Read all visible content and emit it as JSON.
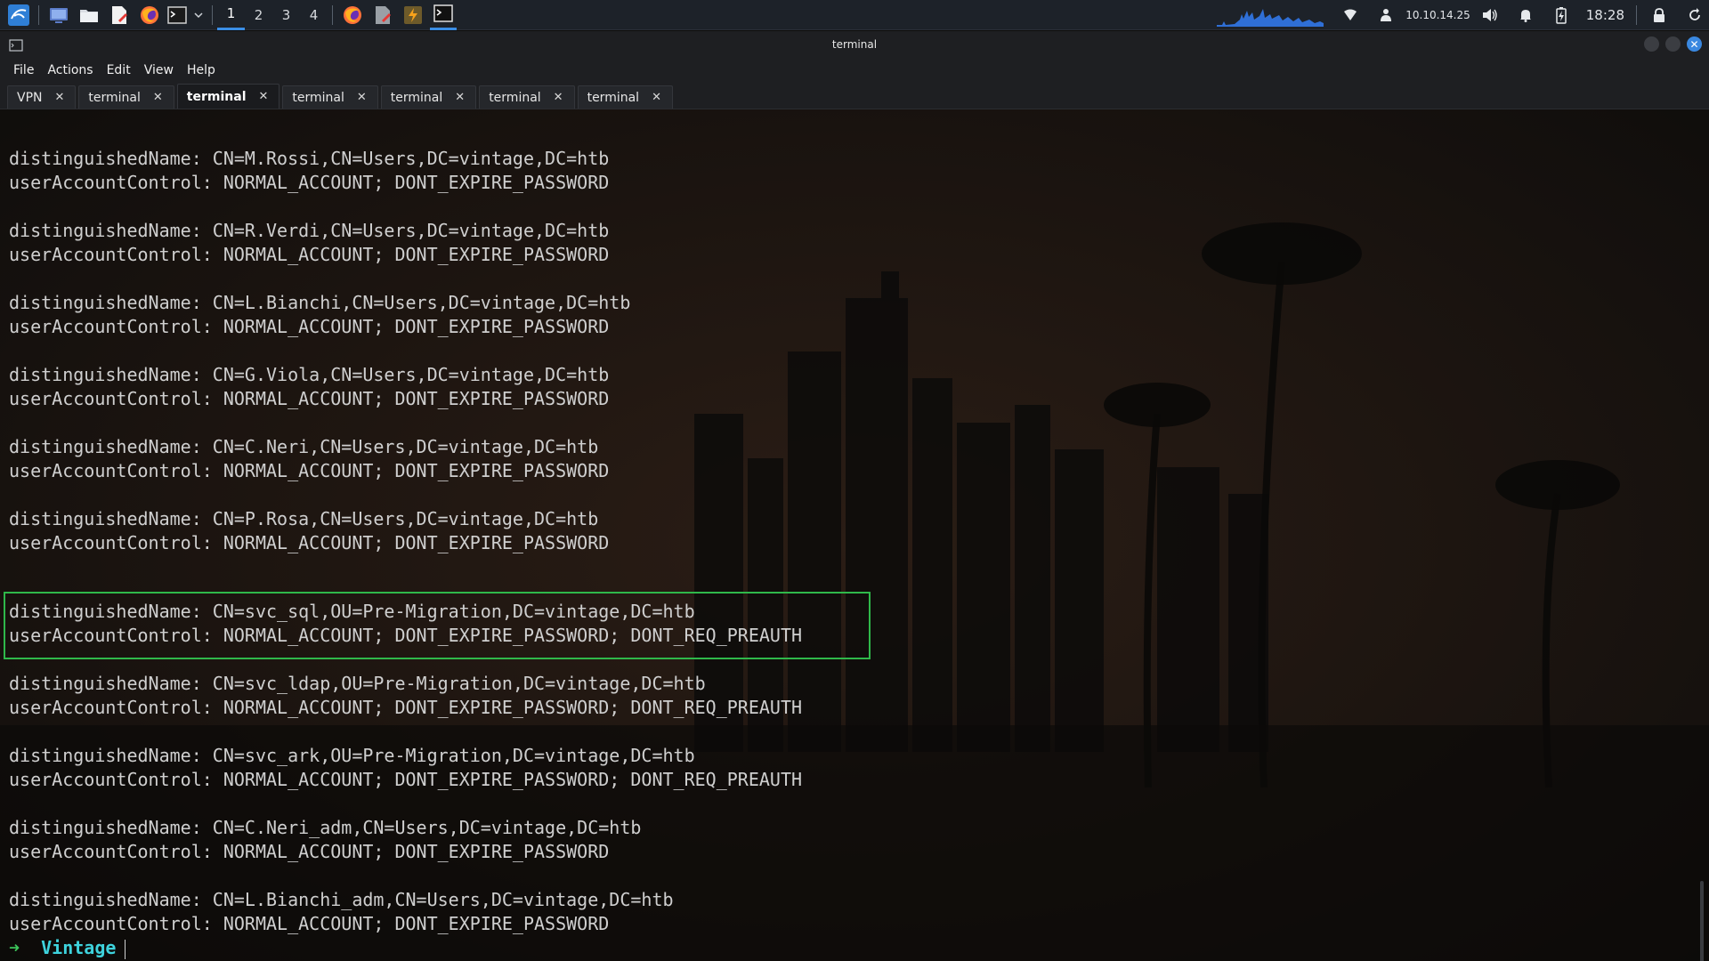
{
  "panel": {
    "workspaces": [
      "1",
      "2",
      "3",
      "4"
    ],
    "active_workspace": "1",
    "ip": "10.10.14.25",
    "clock": "18:28"
  },
  "window": {
    "title": "terminal",
    "menu": [
      "File",
      "Actions",
      "Edit",
      "View",
      "Help"
    ],
    "tabs": [
      {
        "label": "VPN",
        "active": false
      },
      {
        "label": "terminal",
        "active": false
      },
      {
        "label": "terminal",
        "active": true
      },
      {
        "label": "terminal",
        "active": false
      },
      {
        "label": "terminal",
        "active": false
      },
      {
        "label": "terminal",
        "active": false
      },
      {
        "label": "terminal",
        "active": false
      }
    ],
    "close_glyph": "✕"
  },
  "terminal": {
    "entries": [
      {
        "dn": "distinguishedName: CN=M.Rossi,CN=Users,DC=vintage,DC=htb",
        "uac": "userAccountControl: NORMAL_ACCOUNT; DONT_EXPIRE_PASSWORD"
      },
      {
        "dn": "distinguishedName: CN=R.Verdi,CN=Users,DC=vintage,DC=htb",
        "uac": "userAccountControl: NORMAL_ACCOUNT; DONT_EXPIRE_PASSWORD"
      },
      {
        "dn": "distinguishedName: CN=L.Bianchi,CN=Users,DC=vintage,DC=htb",
        "uac": "userAccountControl: NORMAL_ACCOUNT; DONT_EXPIRE_PASSWORD"
      },
      {
        "dn": "distinguishedName: CN=G.Viola,CN=Users,DC=vintage,DC=htb",
        "uac": "userAccountControl: NORMAL_ACCOUNT; DONT_EXPIRE_PASSWORD"
      },
      {
        "dn": "distinguishedName: CN=C.Neri,CN=Users,DC=vintage,DC=htb",
        "uac": "userAccountControl: NORMAL_ACCOUNT; DONT_EXPIRE_PASSWORD"
      },
      {
        "dn": "distinguishedName: CN=P.Rosa,CN=Users,DC=vintage,DC=htb",
        "uac": "userAccountControl: NORMAL_ACCOUNT; DONT_EXPIRE_PASSWORD"
      },
      {
        "dn": "distinguishedName: CN=svc_sql,OU=Pre-Migration,DC=vintage,DC=htb",
        "uac": "userAccountControl: NORMAL_ACCOUNT; DONT_EXPIRE_PASSWORD; DONT_REQ_PREAUTH",
        "highlighted": true
      },
      {
        "dn": "distinguishedName: CN=svc_ldap,OU=Pre-Migration,DC=vintage,DC=htb",
        "uac": "userAccountControl: NORMAL_ACCOUNT; DONT_EXPIRE_PASSWORD; DONT_REQ_PREAUTH"
      },
      {
        "dn": "distinguishedName: CN=svc_ark,OU=Pre-Migration,DC=vintage,DC=htb",
        "uac": "userAccountControl: NORMAL_ACCOUNT; DONT_EXPIRE_PASSWORD; DONT_REQ_PREAUTH"
      },
      {
        "dn": "distinguishedName: CN=C.Neri_adm,CN=Users,DC=vintage,DC=htb",
        "uac": "userAccountControl: NORMAL_ACCOUNT; DONT_EXPIRE_PASSWORD"
      },
      {
        "dn": "distinguishedName: CN=L.Bianchi_adm,CN=Users,DC=vintage,DC=htb",
        "uac": "userAccountControl: NORMAL_ACCOUNT; DONT_EXPIRE_PASSWORD"
      }
    ],
    "prompt": {
      "arrow": "➜",
      "dir": "Vintage"
    }
  },
  "colors": {
    "highlight_border": "#2fb84a",
    "prompt_arrow": "#3cc45a",
    "prompt_dir": "#3ed3dd",
    "accent": "#3a8ee6"
  },
  "icons": {
    "panel": [
      "kali-menu-icon",
      "desktop-icon",
      "file-manager-icon",
      "text-editor-icon",
      "firefox-icon",
      "terminal-icon",
      "chevron-down-icon"
    ],
    "tasks": [
      "firefox-task-icon",
      "editor-task-icon",
      "burp-task-icon",
      "terminal-task-icon"
    ],
    "tray": [
      "wifi-icon",
      "vpn-icon",
      "volume-icon",
      "bell-icon",
      "battery-icon",
      "lock-icon",
      "refresh-icon"
    ]
  }
}
